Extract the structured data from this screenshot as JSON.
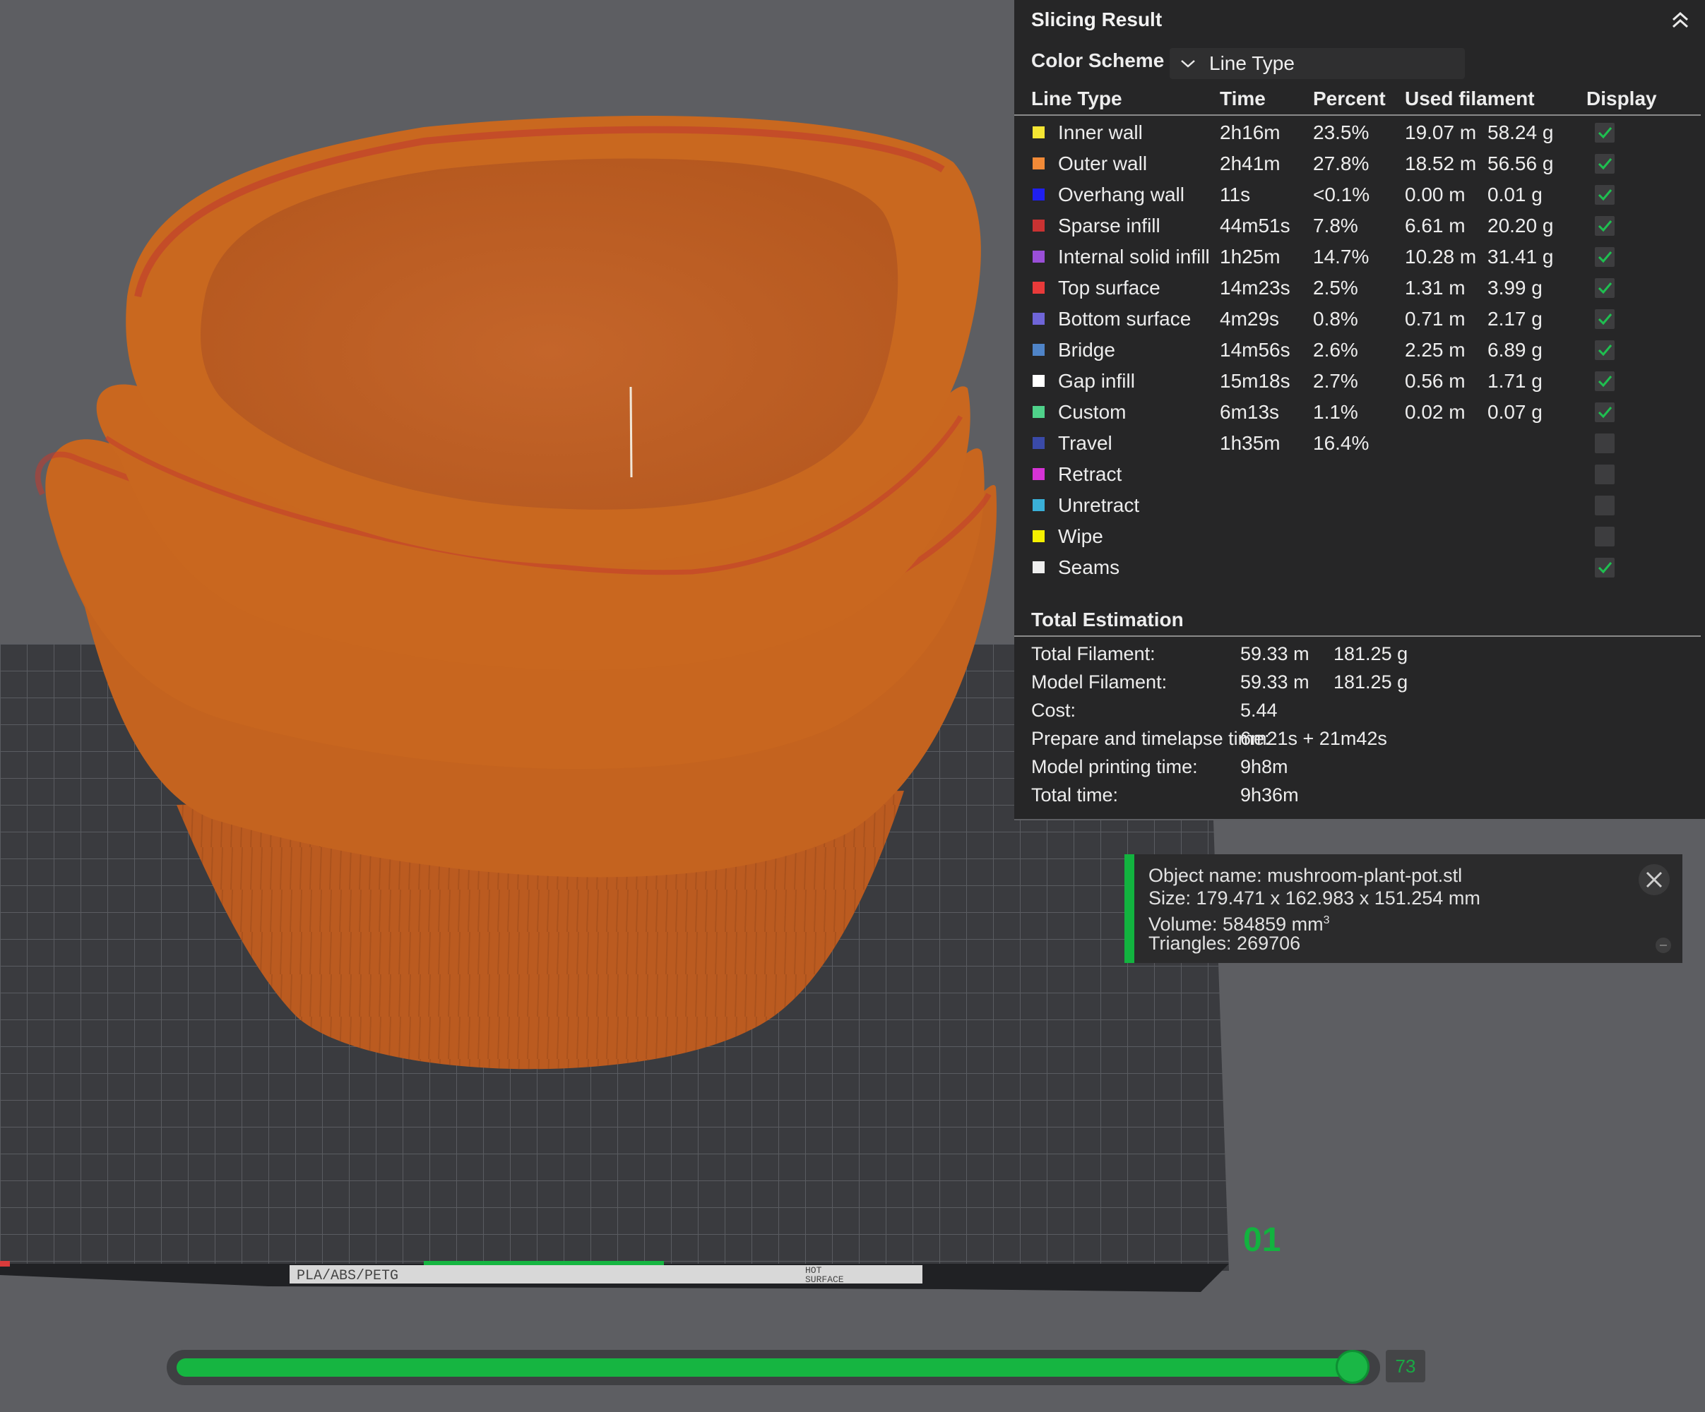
{
  "panel": {
    "title": "Slicing Result",
    "color_scheme_label": "Color Scheme",
    "color_scheme_value": "Line Type",
    "headers": {
      "line_type": "Line Type",
      "time": "Time",
      "percent": "Percent",
      "used_filament": "Used filament",
      "display": "Display"
    },
    "rows": [
      {
        "name": "Inner wall",
        "color": "#f5e633",
        "time": "2h16m",
        "percent": "23.5%",
        "length": "19.07 m",
        "weight": "58.24 g",
        "display": true
      },
      {
        "name": "Outer wall",
        "color": "#f28a37",
        "time": "2h41m",
        "percent": "27.8%",
        "length": "18.52 m",
        "weight": "56.56 g",
        "display": true
      },
      {
        "name": "Overhang wall",
        "color": "#1f1ff0",
        "time": "11s",
        "percent": "<0.1%",
        "length": "0.00 m",
        "weight": "0.01 g",
        "display": true
      },
      {
        "name": "Sparse infill",
        "color": "#c93232",
        "time": "44m51s",
        "percent": "7.8%",
        "length": "6.61 m",
        "weight": "20.20 g",
        "display": true
      },
      {
        "name": "Internal solid infill",
        "color": "#9a4fd8",
        "time": "1h25m",
        "percent": "14.7%",
        "length": "10.28 m",
        "weight": "31.41 g",
        "display": true
      },
      {
        "name": "Top surface",
        "color": "#e83a3a",
        "time": "14m23s",
        "percent": "2.5%",
        "length": "1.31 m",
        "weight": "3.99 g",
        "display": true
      },
      {
        "name": "Bottom surface",
        "color": "#6f65d8",
        "time": "4m29s",
        "percent": "0.8%",
        "length": "0.71 m",
        "weight": "2.17 g",
        "display": true
      },
      {
        "name": "Bridge",
        "color": "#4f84c8",
        "time": "14m56s",
        "percent": "2.6%",
        "length": "2.25 m",
        "weight": "6.89 g",
        "display": true
      },
      {
        "name": "Gap infill",
        "color": "#ffffff",
        "time": "15m18s",
        "percent": "2.7%",
        "length": "0.56 m",
        "weight": "1.71 g",
        "display": true
      },
      {
        "name": "Custom",
        "color": "#4fd18a",
        "time": "6m13s",
        "percent": "1.1%",
        "length": "0.02 m",
        "weight": "0.07 g",
        "display": true
      },
      {
        "name": "Travel",
        "color": "#3a4aa8",
        "time": "1h35m",
        "percent": "16.4%",
        "length": "",
        "weight": "",
        "display": false
      },
      {
        "name": "Retract",
        "color": "#d633d6",
        "time": "",
        "percent": "",
        "length": "",
        "weight": "",
        "display": false
      },
      {
        "name": "Unretract",
        "color": "#3ab0d8",
        "time": "",
        "percent": "",
        "length": "",
        "weight": "",
        "display": false
      },
      {
        "name": "Wipe",
        "color": "#f5f000",
        "time": "",
        "percent": "",
        "length": "",
        "weight": "",
        "display": false
      },
      {
        "name": "Seams",
        "color": "#efefef",
        "time": "",
        "percent": "",
        "length": "",
        "weight": "",
        "display": true
      }
    ],
    "total_title": "Total Estimation",
    "totals": [
      {
        "label": "Total Filament:",
        "value1": "59.33 m",
        "value2": "181.25 g"
      },
      {
        "label": "Model Filament:",
        "value1": "59.33 m",
        "value2": "181.25 g"
      },
      {
        "label": "Cost:",
        "value1": "5.44",
        "value2": ""
      },
      {
        "label": "Prepare and timelapse time:",
        "value1": "6m21s + 21m42s",
        "value2": ""
      },
      {
        "label": "Model printing time:",
        "value1": "9h8m",
        "value2": ""
      },
      {
        "label": "Total time:",
        "value1": "9h36m",
        "value2": ""
      }
    ]
  },
  "object_info": {
    "name_line": "Object name: mushroom-plant-pot.stl",
    "size_line": "Size: 179.471 x 162.983 x 151.254 mm",
    "volume_line": "Volume: 584859 mm",
    "volume_sup": "3",
    "triangles_line": "Triangles: 269706"
  },
  "plate": {
    "number": "01",
    "label_left": "PLA/ABS/PETG",
    "label_right_1": "HOT",
    "label_right_2": "SURFACE"
  },
  "slider": {
    "value": "73",
    "fraction": 0.985
  },
  "colors": {
    "model": "#c05f22",
    "accent": "#16b541",
    "panel_bg": "#262627"
  },
  "icons": [
    "collapse-up-icon",
    "chevron-down-icon",
    "checkmark-icon",
    "close-icon"
  ]
}
